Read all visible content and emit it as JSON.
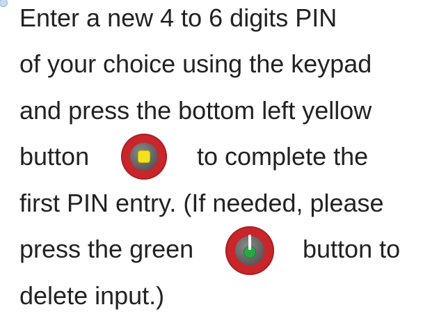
{
  "instructions": {
    "line1": "Enter a new 4 to 6 digits PIN",
    "line2": "of your choice using the keypad",
    "line3": "and press the bottom left yellow",
    "line4_before": "button",
    "line4_after": "to complete the",
    "line5": "first PIN entry.  (If needed, please",
    "line6_before": "press the green",
    "line6_after": "button to",
    "line7": "delete input.)"
  },
  "icons": {
    "confirm_button": "yellow-square-button-icon",
    "delete_button": "green-power-button-icon"
  },
  "colors": {
    "button_bezel": "#c9262c",
    "confirm_key": "#f2e21b",
    "delete_key": "#27a844",
    "text": "#222222"
  }
}
